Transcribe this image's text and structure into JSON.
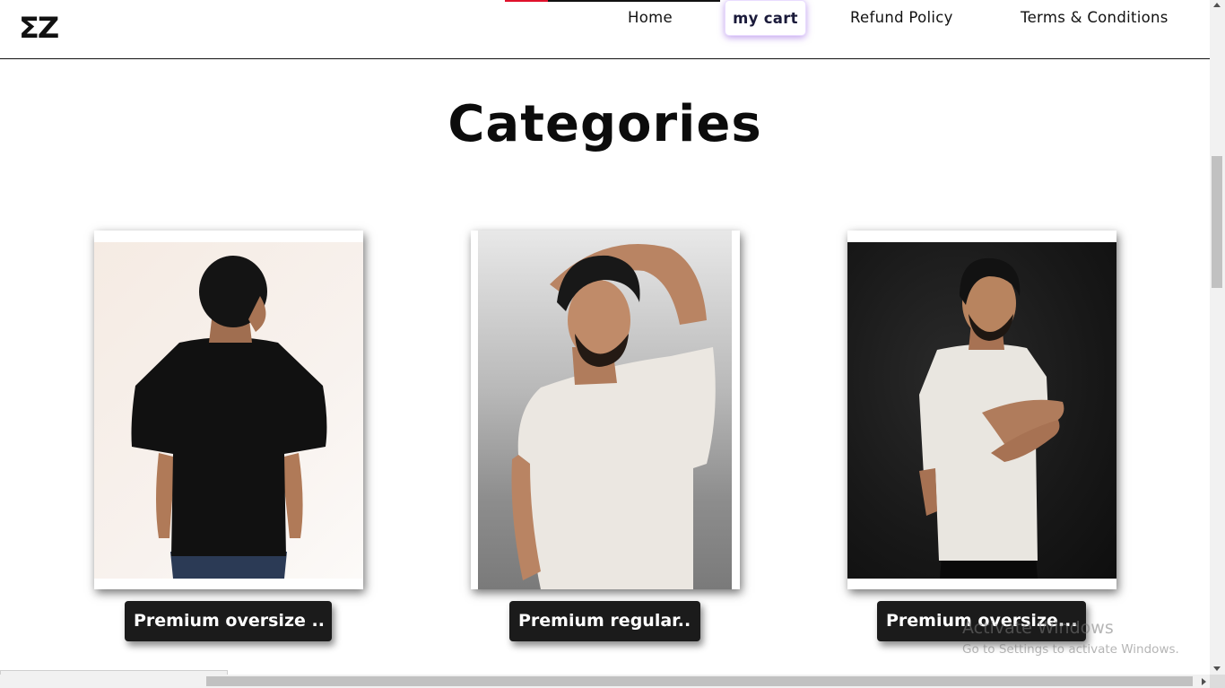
{
  "header": {
    "logo": "ΣZ",
    "nav": {
      "home": "Home",
      "cart": "my cart",
      "refund": "Refund Policy",
      "terms": "Terms & Conditions"
    }
  },
  "main": {
    "title": "Categories",
    "categories": [
      {
        "label": "Premium oversize ..",
        "shirt_color": "#111111",
        "background": "cream"
      },
      {
        "label": "Premium regular..",
        "shirt_color": "#ebe7e1",
        "background": "grey"
      },
      {
        "label": "Premium oversize...",
        "shirt_color": "#e9e6e0",
        "background": "black"
      }
    ]
  },
  "status_bar": {
    "url": "https://tanishtirpathi.github.io/EZwears/#"
  },
  "watermark": {
    "line1": "Activate Windows",
    "line2": "Go to Settings to activate Windows."
  },
  "colors": {
    "accent_red": "#e0112b",
    "cart_glow": "#8c50dc",
    "label_bg": "#1b1b1b"
  }
}
